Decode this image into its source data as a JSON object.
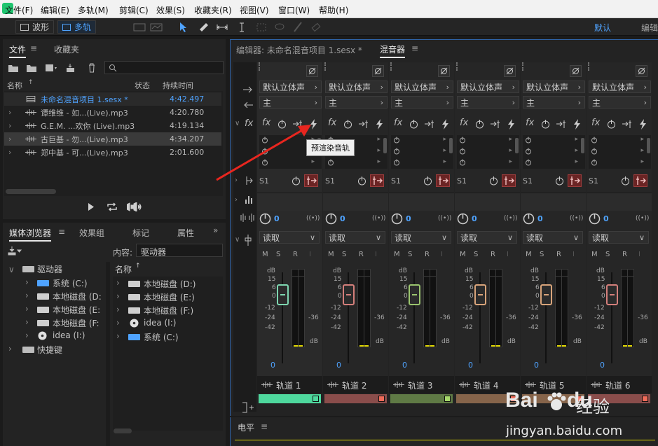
{
  "menubar": {
    "items": [
      "文件(F)",
      "编辑(E)",
      "多轨(M)",
      "剪辑(C)",
      "效果(S)",
      "收藏夹(R)",
      "视图(V)",
      "窗口(W)",
      "帮助(H)"
    ]
  },
  "toolbar": {
    "waveform": "波形",
    "multitrack": "多轨",
    "workspace": "默认",
    "edit_label": "编辑"
  },
  "files_panel": {
    "tab_files": "文件",
    "tab_favorites": "收藏夹",
    "col_name": "名称",
    "col_status": "状态",
    "col_duration": "持续时间",
    "rows": [
      {
        "name": "未命名混音项目 1.sesx *",
        "duration": "4:42.497",
        "highlight": true
      },
      {
        "name": "谭维维 - 如...(Live).mp3",
        "duration": "4:20.780"
      },
      {
        "name": "G.E.M. ...欢你 (Live).mp3",
        "duration": "4:19.134"
      },
      {
        "name": "古巨基 - 勿...(Live).mp3",
        "duration": "4:34.207"
      },
      {
        "name": "郑中基 - 可...(Live).mp3",
        "duration": "2:01.600"
      }
    ]
  },
  "media_panel": {
    "tab_media": "媒体浏览器",
    "tab_effects": "效果组",
    "tab_markers": "标记",
    "tab_props": "属性",
    "content_label": "内容:",
    "content_value": "驱动器",
    "name_col": "名称",
    "tree": [
      "驱动器",
      "系统 (C:)",
      "本地磁盘 (D:",
      "本地磁盘 (E:",
      "本地磁盘 (F:",
      "idea (I:)",
      "快捷键"
    ],
    "list": [
      "本地磁盘 (D:)",
      "本地磁盘 (E:)",
      "本地磁盘 (F:)",
      "idea (I:)",
      "系统 (C:)"
    ]
  },
  "mixer": {
    "editor_tab": "编辑器: 未命名混音项目 1.sesx *",
    "mixer_tab": "混音器",
    "tooltip": "预渲染音轨",
    "level_tab": "电平",
    "strip_common": {
      "input": "默认立体声",
      "output": "主",
      "send": "S1",
      "pan": "0",
      "mode": "读取",
      "msri": [
        "M",
        "S",
        "R",
        "I"
      ],
      "db_label": "dB",
      "scale": [
        "15",
        "6",
        "0",
        "-12",
        "-24",
        "-42",
        "-36"
      ],
      "volume": "0"
    },
    "tracks": [
      {
        "name": "轨道 1",
        "color": "#4ed89d",
        "fader_color": "#7ed6b0"
      },
      {
        "name": "轨道 2",
        "color": "#8a4d4b",
        "fader_color": "#d47f7b"
      },
      {
        "name": "轨道 3",
        "color": "#5f7a45",
        "fader_color": "#9ac46e"
      },
      {
        "name": "轨道 4",
        "color": "#86644a",
        "fader_color": "#d8a47a"
      },
      {
        "name": "轨道 5",
        "color": "#86644a",
        "fader_color": "#d8a47a"
      },
      {
        "name": "轨道 6",
        "color": "#8a4d4b",
        "fader_color": "#d47f7b"
      }
    ]
  },
  "watermark": {
    "brand": "Bai",
    "brand2": "du",
    "suffix": "经验",
    "url": "jingyan.baidu.com"
  }
}
